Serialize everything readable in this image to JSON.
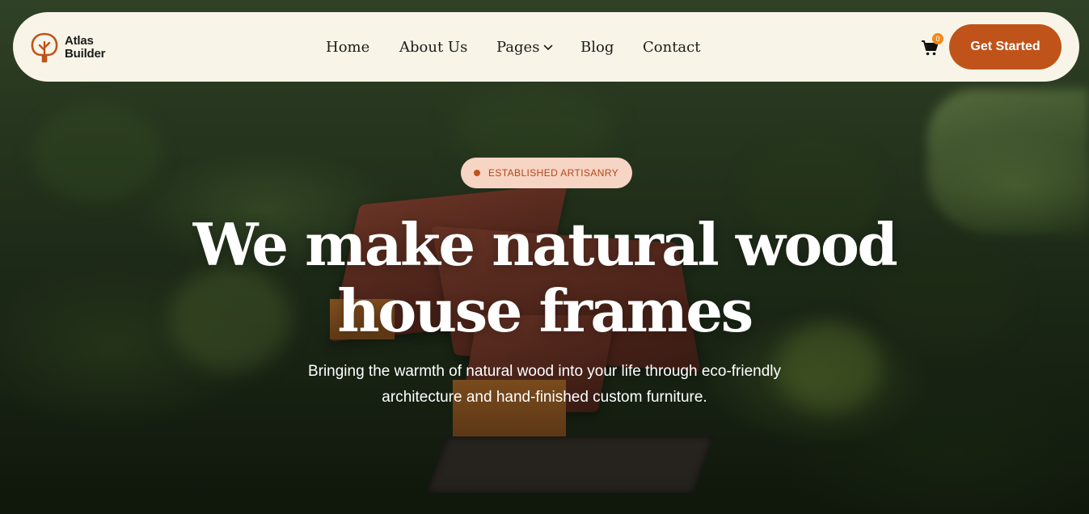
{
  "brand": {
    "line1": "Atlas",
    "line2": "Builder",
    "logo_icon": "tree-icon"
  },
  "nav": {
    "items": [
      {
        "label": "Home"
      },
      {
        "label": "About Us"
      },
      {
        "label": "Pages"
      },
      {
        "label": "Blog"
      },
      {
        "label": "Contact"
      }
    ],
    "cart_icon": "cart-icon",
    "cart_count": "0",
    "cta_label": "Get Started"
  },
  "hero": {
    "badge": "ESTABLISHED ARTISANRY",
    "headline_line1": "We make natural wood",
    "headline_line2": "house frames",
    "subtitle_line1": "Bringing the warmth of natural wood into your life through eco-friendly",
    "subtitle_line2": "architecture and hand-finished custom furniture."
  },
  "colors": {
    "accent": "#c0531a",
    "nav_background": "#f8f5e8",
    "badge_background": "#f6d5c4",
    "cart_badge": "#f08a1c"
  }
}
